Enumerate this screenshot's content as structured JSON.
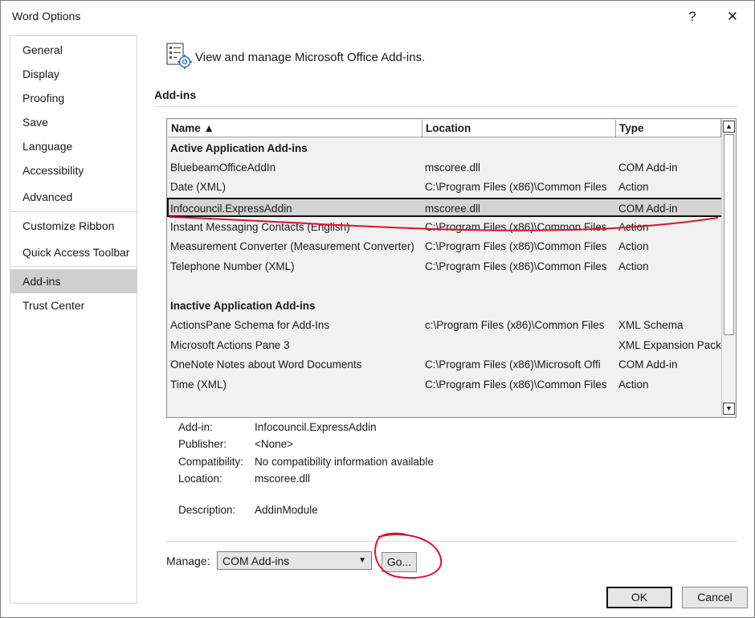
{
  "window": {
    "title": "Word Options",
    "help_label": "?",
    "close_label": "✕"
  },
  "nav": {
    "items": [
      {
        "label": "General"
      },
      {
        "label": "Display"
      },
      {
        "label": "Proofing"
      },
      {
        "label": "Save"
      },
      {
        "label": "Language"
      },
      {
        "label": "Accessibility"
      },
      {
        "label": "Advanced"
      },
      {
        "label": "Customize Ribbon"
      },
      {
        "label": "Quick Access Toolbar"
      },
      {
        "label": "Add-ins",
        "selected": true
      },
      {
        "label": "Trust Center"
      }
    ]
  },
  "header": {
    "icon": "addins-gear-icon",
    "text": "View and manage Microsoft Office Add-ins."
  },
  "section": {
    "title": "Add-ins"
  },
  "list": {
    "columns": [
      {
        "label": "Name ▲"
      },
      {
        "label": "Location"
      },
      {
        "label": "Type"
      }
    ],
    "rows": [
      {
        "kind": "group",
        "name": "Active Application Add-ins",
        "location": "",
        "type": ""
      },
      {
        "kind": "item",
        "name": "BluebeamOfficeAddIn",
        "location": "mscoree.dll",
        "type": "COM Add-in"
      },
      {
        "kind": "item",
        "name": "Date (XML)",
        "location": "C:\\Program Files (x86)\\Common Files",
        "type": "Action"
      },
      {
        "kind": "item",
        "name": "Infocouncil.ExpressAddin",
        "location": "mscoree.dll",
        "type": "COM Add-in",
        "selected": true
      },
      {
        "kind": "item",
        "name": "Instant Messaging Contacts (English)",
        "location": "C:\\Program Files (x86)\\Common Files",
        "type": "Action"
      },
      {
        "kind": "item",
        "name": "Measurement Converter (Measurement Converter)",
        "location": "C:\\Program Files (x86)\\Common Files",
        "type": "Action"
      },
      {
        "kind": "item",
        "name": "Telephone Number (XML)",
        "location": "C:\\Program Files (x86)\\Common Files",
        "type": "Action"
      },
      {
        "kind": "blank",
        "name": "",
        "location": "",
        "type": ""
      },
      {
        "kind": "group",
        "name": "Inactive Application Add-ins",
        "location": "",
        "type": ""
      },
      {
        "kind": "item",
        "name": "ActionsPane Schema for Add-Ins",
        "location": "c:\\Program Files (x86)\\Common Files",
        "type": "XML Schema"
      },
      {
        "kind": "item",
        "name": "Microsoft Actions Pane 3",
        "location": "",
        "type": "XML Expansion Pack"
      },
      {
        "kind": "item",
        "name": "OneNote Notes about Word Documents",
        "location": "C:\\Program Files (x86)\\Microsoft Offi",
        "type": "COM Add-in"
      },
      {
        "kind": "item",
        "name": "Time (XML)",
        "location": "C:\\Program Files (x86)\\Common Files",
        "type": "Action"
      }
    ]
  },
  "details": [
    {
      "label": "Add-in:",
      "value": "Infocouncil.ExpressAddin"
    },
    {
      "label": "Publisher:",
      "value": "<None>"
    },
    {
      "label": "Compatibility:",
      "value": "No compatibility information available"
    },
    {
      "label": "Location:",
      "value": "mscoree.dll"
    },
    {
      "label": "Description:",
      "value": "AddinModule"
    }
  ],
  "manage": {
    "label": "Manage:",
    "value": "COM Add-ins",
    "go_label": "Go..."
  },
  "footer": {
    "ok_label": "OK",
    "cancel_label": "Cancel"
  },
  "colors": {
    "selection": "#cfcfcf",
    "annotation": "#e0102a"
  }
}
